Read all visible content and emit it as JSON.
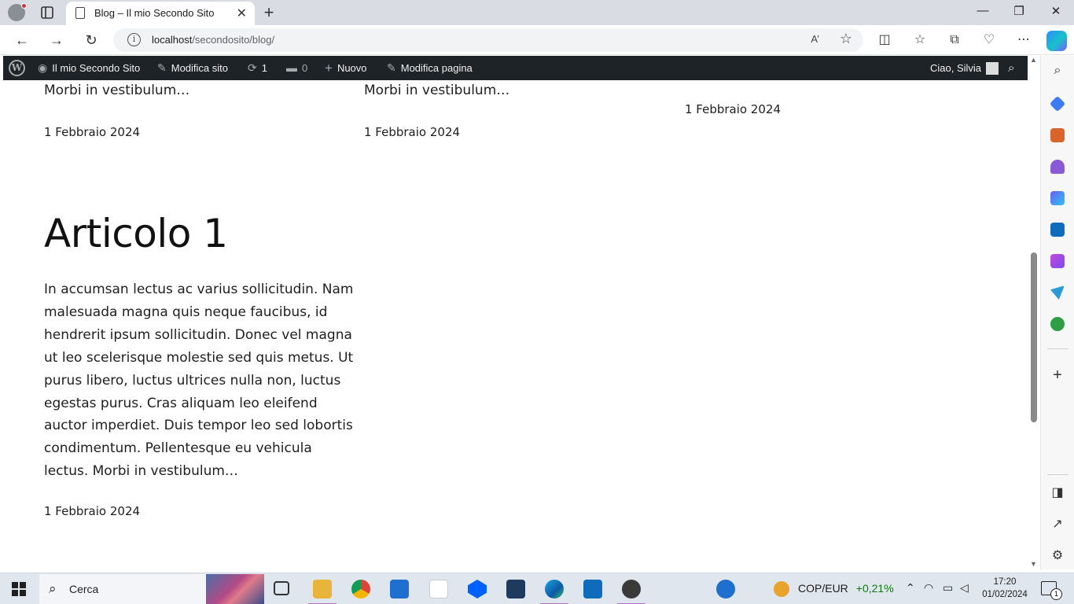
{
  "browser": {
    "tab_title": "Blog – Il mio Secondo Sito",
    "url_host": "localhost",
    "url_path": "/secondosito/blog/",
    "read_aloud_label": "A’"
  },
  "admin_bar": {
    "site_name": "Il mio Secondo Sito",
    "customize": "Modifica sito",
    "updates_count": "1",
    "comments_count": "0",
    "new_label": "Nuovo",
    "edit_page": "Modifica pagina",
    "greeting": "Ciao, Silvia"
  },
  "posts_top": [
    {
      "excerpt_end": "Morbi in vestibulum…",
      "date": "1 Febbraio 2024"
    },
    {
      "excerpt_end": "Morbi in vestibulum…",
      "date": "1 Febbraio 2024"
    },
    {
      "excerpt_end": "",
      "date": "1 Febbraio 2024"
    }
  ],
  "post_main": {
    "title": "Articolo 1",
    "body": "In accumsan lectus ac varius sollicitudin. Nam malesuada magna quis neque faucibus, id hendrerit ipsum sollicitudin. Donec vel magna ut leo scelerisque molestie sed quis metus. Ut purus libero, luctus ultrices nulla non, luctus egestas purus. Cras aliquam leo eleifend auctor imperdiet. Duis tempor leo sed lobortis condimentum. Pellentesque eu vehicula lectus. Morbi in vestibulum…",
    "date": "1 Febbraio 2024"
  },
  "taskbar": {
    "search_label": "Cerca",
    "ticker_pair": "COP/EUR",
    "ticker_change": "+0,21%",
    "time": "17:20",
    "date": "01/02/2024",
    "notification_count": "1"
  },
  "icons": {
    "sidebar": [
      "search-icon",
      "tag-icon",
      "briefcase-icon",
      "chess-icon",
      "copilot-app-icon",
      "outlook-icon",
      "designer-icon",
      "send-icon",
      "tree-icon",
      "plus-icon",
      "sidebar-toggle-icon",
      "external-link-icon",
      "gear-icon"
    ]
  },
  "colors": {
    "admin_bar_bg": "#1d2327",
    "admin_bar_text": "#f0f0f1",
    "taskbar_bg": "#dfe6ee",
    "ticker_positive": "#0e7a0d"
  }
}
